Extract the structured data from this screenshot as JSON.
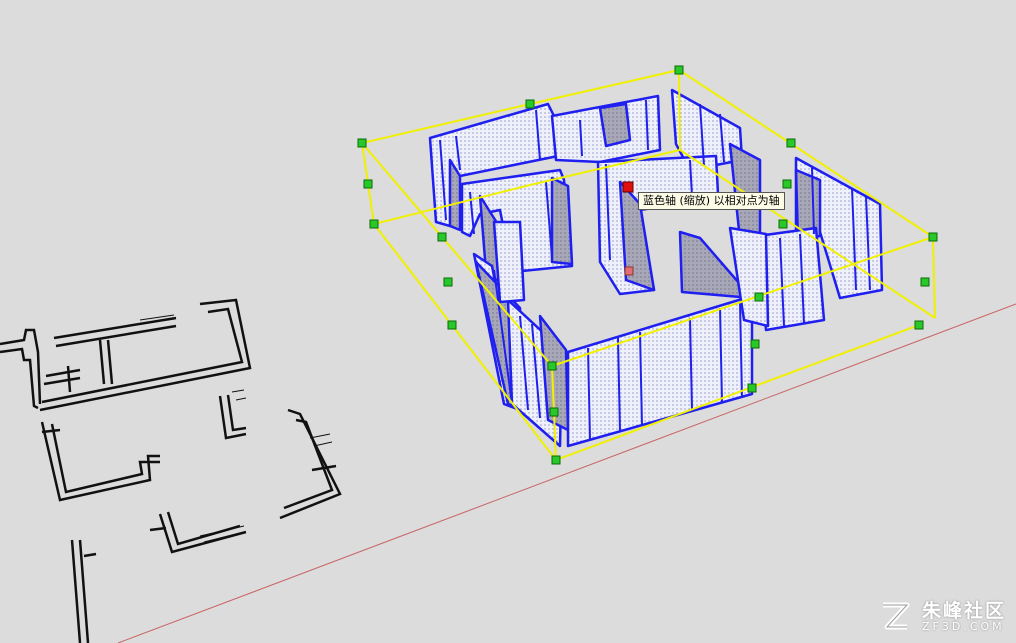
{
  "tooltip": {
    "text": "蓝色轴 (缩放) 以相对点为轴"
  },
  "watermark": {
    "name": "朱峰社区",
    "url": "ZF3D.COM"
  },
  "colors": {
    "background": "#dcdcdc",
    "selection_box": "#f0f000",
    "grip": "#28c828",
    "active_grip": "#e01010",
    "walls": "#1f1ff0",
    "red_axis": "#c86464"
  }
}
